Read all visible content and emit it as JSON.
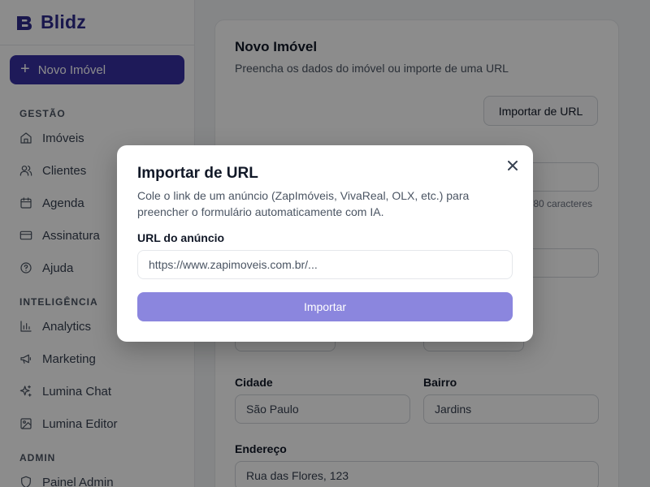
{
  "brand": {
    "name": "Blidz"
  },
  "sidebar": {
    "new_button_label": "Novo Imóvel",
    "sections": [
      {
        "title": "GESTÃO"
      },
      {
        "title": "INTELIGÊNCIA"
      },
      {
        "title": "ADMIN"
      }
    ],
    "items": [
      {
        "label": "Imóveis",
        "icon": "home-icon"
      },
      {
        "label": "Clientes",
        "icon": "users-icon"
      },
      {
        "label": "Agenda",
        "icon": "calendar-icon"
      },
      {
        "label": "Assinatura",
        "icon": "credit-card-icon"
      },
      {
        "label": "Ajuda",
        "icon": "help-circle-icon"
      },
      {
        "label": "Analytics",
        "icon": "bar-chart-icon"
      },
      {
        "label": "Marketing",
        "icon": "megaphone-icon"
      },
      {
        "label": "Lumina Chat",
        "icon": "sparkles-icon"
      },
      {
        "label": "Lumina Editor",
        "icon": "image-icon"
      },
      {
        "label": "Painel Admin",
        "icon": "shield-icon"
      }
    ]
  },
  "main": {
    "title": "Novo Imóvel",
    "subtitle": "Preencha os dados do imóvel ou importe de uma URL",
    "import_button_label": "Importar de URL",
    "char_count_text": "/80 caracteres",
    "fields": {
      "cidade": {
        "label": "Cidade",
        "value": "São Paulo"
      },
      "bairro": {
        "label": "Bairro",
        "value": "Jardins"
      },
      "endereco": {
        "label": "Endereço",
        "value": "Rua das Flores, 123"
      }
    }
  },
  "modal": {
    "title": "Importar de URL",
    "description": "Cole o link de um anúncio (ZapImóveis, VivaReal, OLX, etc.) para preencher o formulário automaticamente com IA.",
    "url_label": "URL do anúncio",
    "url_placeholder": "https://www.zapimoveis.com.br/...",
    "url_value": "",
    "submit_label": "Importar"
  },
  "colors": {
    "brand": "#2e2a8c",
    "primary_button": "#3730a3",
    "disabled_button": "#8b86de",
    "overlay": "rgba(0,0,0,0.45)"
  }
}
